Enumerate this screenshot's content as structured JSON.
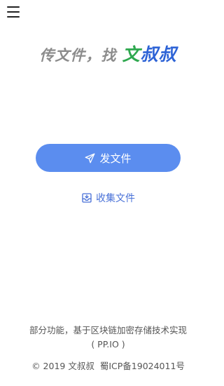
{
  "header": {
    "menu_icon": "hamburger-menu-icon"
  },
  "tagline": {
    "prefix": "传文件，找",
    "brand_part1": "文",
    "brand_part2": "叔叔"
  },
  "actions": {
    "send_label": "发文件",
    "send_icon": "paper-plane-icon",
    "collect_label": "收集文件",
    "collect_icon": "inbox-tray-icon"
  },
  "footer": {
    "note_line1": "部分功能，基于区块链加密存储技术实现",
    "note_line2": "( PP.IO )",
    "copyright": "© 2019 文叔叔",
    "icp": "蜀ICP备19024011号"
  },
  "colors": {
    "primary_button": "#5b8def",
    "brand_green": "#2fa84f",
    "brand_blue": "#2d63d6",
    "link_blue": "#4a72d8"
  }
}
